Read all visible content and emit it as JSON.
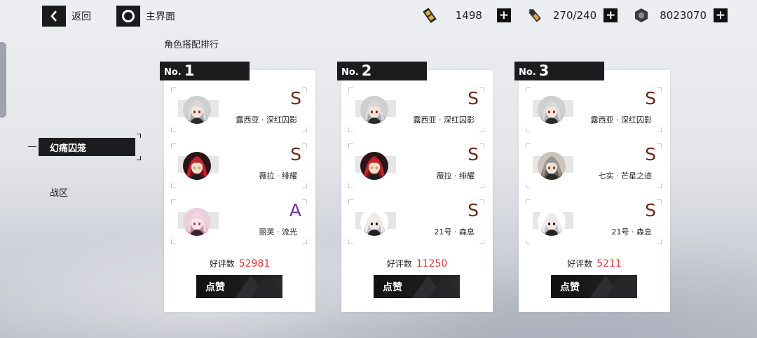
{
  "topbar": {
    "back_label": "返回",
    "home_label": "主界面",
    "resources": [
      {
        "icon": "ticket-icon",
        "value": "1498"
      },
      {
        "icon": "battery-icon",
        "value": "270/240"
      },
      {
        "icon": "hexagon-coin-icon",
        "value": "8023070"
      }
    ]
  },
  "section_title": "角色搭配排行",
  "sidebar": {
    "active_label": "幻痛囚笼",
    "items": [
      {
        "label": "战区"
      }
    ]
  },
  "cards": [
    {
      "no_prefix": "No.",
      "rank": "1",
      "characters": [
        {
          "grade": "S",
          "name": "露西亚 · 深红囚影",
          "avatar": "white-hair"
        },
        {
          "grade": "S",
          "name": "薇拉 · 绯耀",
          "avatar": "red-hair"
        },
        {
          "grade": "A",
          "name": "丽芙 · 流光",
          "avatar": "pink-hair"
        }
      ],
      "likes_label": "好评数",
      "likes": "52981",
      "like_button": "点赞"
    },
    {
      "no_prefix": "No.",
      "rank": "2",
      "characters": [
        {
          "grade": "S",
          "name": "露西亚 · 深红囚影",
          "avatar": "white-hair"
        },
        {
          "grade": "S",
          "name": "薇拉 · 绯耀",
          "avatar": "red-hair"
        },
        {
          "grade": "S",
          "name": "21号 · 森息",
          "avatar": "silver-hair"
        }
      ],
      "likes_label": "好评数",
      "likes": "11250",
      "like_button": "点赞"
    },
    {
      "no_prefix": "No.",
      "rank": "3",
      "characters": [
        {
          "grade": "S",
          "name": "露西亚 · 深红囚影",
          "avatar": "white-hair"
        },
        {
          "grade": "S",
          "name": "七实 · 芒星之迹",
          "avatar": "gray-hair"
        },
        {
          "grade": "S",
          "name": "21号 · 森息",
          "avatar": "silver-hair"
        }
      ],
      "likes_label": "好评数",
      "likes": "5211",
      "like_button": "点赞"
    }
  ],
  "colors": {
    "grade_S": "#6b2a18",
    "grade_A": "#7a2f9e",
    "likes_value": "#e03636",
    "dark_panel": "#1c1c1e"
  }
}
